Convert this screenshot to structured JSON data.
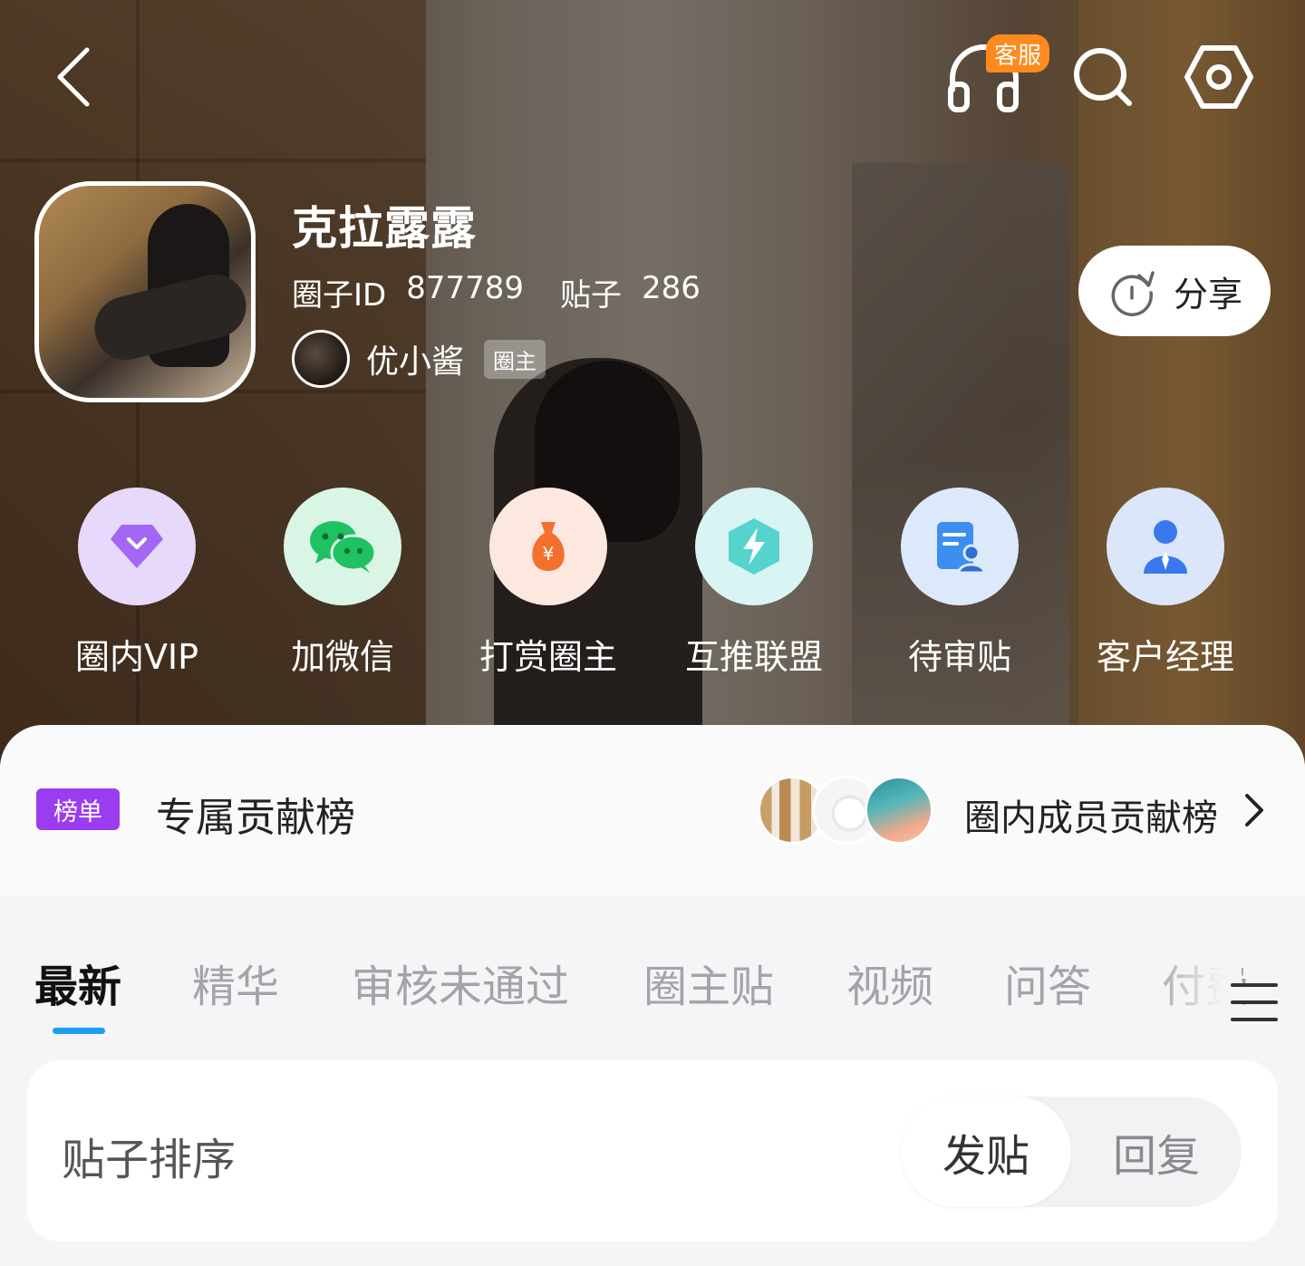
{
  "header": {
    "back_icon": "chevron-left-icon",
    "service_badge": "客服",
    "service_icon": "headset-icon",
    "search_icon": "search-icon",
    "settings_icon": "hexagon-settings-icon"
  },
  "circle": {
    "name": "克拉露露",
    "id_label": "圈子ID",
    "id_value": "877789",
    "posts_label": "贴子",
    "posts_value": "286",
    "owner_name": "优小酱",
    "owner_tag": "圈主"
  },
  "share": {
    "label": "分享",
    "icon": "share-refresh-icon"
  },
  "features": [
    {
      "label": "圈内VIP",
      "icon": "diamond-vip-icon",
      "bg": "#e6d9fb",
      "color": "#9b59f0"
    },
    {
      "label": "加微信",
      "icon": "wechat-icon",
      "bg": "#d9f5e6",
      "color": "#1fc160"
    },
    {
      "label": "打赏圈主",
      "icon": "money-bag-icon",
      "bg": "#fde8df",
      "color": "#f4702e"
    },
    {
      "label": "互推联盟",
      "icon": "lightning-hexagon-icon",
      "bg": "#d8f4f3",
      "color": "#3cc9c2"
    },
    {
      "label": "待审贴",
      "icon": "pending-document-icon",
      "bg": "#dbe9fb",
      "color": "#3c8ef0"
    },
    {
      "label": "客户经理",
      "icon": "manager-person-icon",
      "bg": "#dbe6fb",
      "color": "#3a78ee"
    }
  ],
  "ranking": {
    "tag": "榜单",
    "title": "专属贡献榜",
    "link_label": "圈内成员贡献榜",
    "accent": "#9b3cf0"
  },
  "tabs": [
    "最新",
    "精华",
    "审核未通过",
    "圈主贴",
    "视频",
    "问答",
    "付费"
  ],
  "active_tab": "最新",
  "tab_accent": "#1aa0f0",
  "sort": {
    "label": "贴子排序",
    "options": [
      "发贴",
      "回复"
    ],
    "selected": "发贴"
  }
}
